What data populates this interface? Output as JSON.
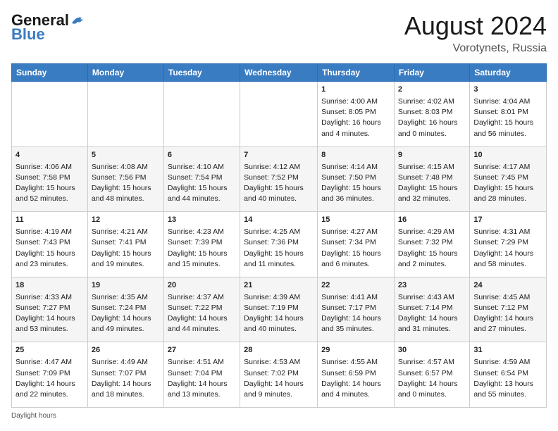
{
  "header": {
    "logo_line1": "General",
    "logo_line2": "Blue",
    "month_year": "August 2024",
    "location": "Vorotynets, Russia"
  },
  "days_of_week": [
    "Sunday",
    "Monday",
    "Tuesday",
    "Wednesday",
    "Thursday",
    "Friday",
    "Saturday"
  ],
  "weeks": [
    [
      {
        "day": "",
        "lines": []
      },
      {
        "day": "",
        "lines": []
      },
      {
        "day": "",
        "lines": []
      },
      {
        "day": "",
        "lines": []
      },
      {
        "day": "1",
        "lines": [
          "Sunrise: 4:00 AM",
          "Sunset: 8:05 PM",
          "Daylight: 16 hours",
          "and 4 minutes."
        ]
      },
      {
        "day": "2",
        "lines": [
          "Sunrise: 4:02 AM",
          "Sunset: 8:03 PM",
          "Daylight: 16 hours",
          "and 0 minutes."
        ]
      },
      {
        "day": "3",
        "lines": [
          "Sunrise: 4:04 AM",
          "Sunset: 8:01 PM",
          "Daylight: 15 hours",
          "and 56 minutes."
        ]
      }
    ],
    [
      {
        "day": "4",
        "lines": [
          "Sunrise: 4:06 AM",
          "Sunset: 7:58 PM",
          "Daylight: 15 hours",
          "and 52 minutes."
        ]
      },
      {
        "day": "5",
        "lines": [
          "Sunrise: 4:08 AM",
          "Sunset: 7:56 PM",
          "Daylight: 15 hours",
          "and 48 minutes."
        ]
      },
      {
        "day": "6",
        "lines": [
          "Sunrise: 4:10 AM",
          "Sunset: 7:54 PM",
          "Daylight: 15 hours",
          "and 44 minutes."
        ]
      },
      {
        "day": "7",
        "lines": [
          "Sunrise: 4:12 AM",
          "Sunset: 7:52 PM",
          "Daylight: 15 hours",
          "and 40 minutes."
        ]
      },
      {
        "day": "8",
        "lines": [
          "Sunrise: 4:14 AM",
          "Sunset: 7:50 PM",
          "Daylight: 15 hours",
          "and 36 minutes."
        ]
      },
      {
        "day": "9",
        "lines": [
          "Sunrise: 4:15 AM",
          "Sunset: 7:48 PM",
          "Daylight: 15 hours",
          "and 32 minutes."
        ]
      },
      {
        "day": "10",
        "lines": [
          "Sunrise: 4:17 AM",
          "Sunset: 7:45 PM",
          "Daylight: 15 hours",
          "and 28 minutes."
        ]
      }
    ],
    [
      {
        "day": "11",
        "lines": [
          "Sunrise: 4:19 AM",
          "Sunset: 7:43 PM",
          "Daylight: 15 hours",
          "and 23 minutes."
        ]
      },
      {
        "day": "12",
        "lines": [
          "Sunrise: 4:21 AM",
          "Sunset: 7:41 PM",
          "Daylight: 15 hours",
          "and 19 minutes."
        ]
      },
      {
        "day": "13",
        "lines": [
          "Sunrise: 4:23 AM",
          "Sunset: 7:39 PM",
          "Daylight: 15 hours",
          "and 15 minutes."
        ]
      },
      {
        "day": "14",
        "lines": [
          "Sunrise: 4:25 AM",
          "Sunset: 7:36 PM",
          "Daylight: 15 hours",
          "and 11 minutes."
        ]
      },
      {
        "day": "15",
        "lines": [
          "Sunrise: 4:27 AM",
          "Sunset: 7:34 PM",
          "Daylight: 15 hours",
          "and 6 minutes."
        ]
      },
      {
        "day": "16",
        "lines": [
          "Sunrise: 4:29 AM",
          "Sunset: 7:32 PM",
          "Daylight: 15 hours",
          "and 2 minutes."
        ]
      },
      {
        "day": "17",
        "lines": [
          "Sunrise: 4:31 AM",
          "Sunset: 7:29 PM",
          "Daylight: 14 hours",
          "and 58 minutes."
        ]
      }
    ],
    [
      {
        "day": "18",
        "lines": [
          "Sunrise: 4:33 AM",
          "Sunset: 7:27 PM",
          "Daylight: 14 hours",
          "and 53 minutes."
        ]
      },
      {
        "day": "19",
        "lines": [
          "Sunrise: 4:35 AM",
          "Sunset: 7:24 PM",
          "Daylight: 14 hours",
          "and 49 minutes."
        ]
      },
      {
        "day": "20",
        "lines": [
          "Sunrise: 4:37 AM",
          "Sunset: 7:22 PM",
          "Daylight: 14 hours",
          "and 44 minutes."
        ]
      },
      {
        "day": "21",
        "lines": [
          "Sunrise: 4:39 AM",
          "Sunset: 7:19 PM",
          "Daylight: 14 hours",
          "and 40 minutes."
        ]
      },
      {
        "day": "22",
        "lines": [
          "Sunrise: 4:41 AM",
          "Sunset: 7:17 PM",
          "Daylight: 14 hours",
          "and 35 minutes."
        ]
      },
      {
        "day": "23",
        "lines": [
          "Sunrise: 4:43 AM",
          "Sunset: 7:14 PM",
          "Daylight: 14 hours",
          "and 31 minutes."
        ]
      },
      {
        "day": "24",
        "lines": [
          "Sunrise: 4:45 AM",
          "Sunset: 7:12 PM",
          "Daylight: 14 hours",
          "and 27 minutes."
        ]
      }
    ],
    [
      {
        "day": "25",
        "lines": [
          "Sunrise: 4:47 AM",
          "Sunset: 7:09 PM",
          "Daylight: 14 hours",
          "and 22 minutes."
        ]
      },
      {
        "day": "26",
        "lines": [
          "Sunrise: 4:49 AM",
          "Sunset: 7:07 PM",
          "Daylight: 14 hours",
          "and 18 minutes."
        ]
      },
      {
        "day": "27",
        "lines": [
          "Sunrise: 4:51 AM",
          "Sunset: 7:04 PM",
          "Daylight: 14 hours",
          "and 13 minutes."
        ]
      },
      {
        "day": "28",
        "lines": [
          "Sunrise: 4:53 AM",
          "Sunset: 7:02 PM",
          "Daylight: 14 hours",
          "and 9 minutes."
        ]
      },
      {
        "day": "29",
        "lines": [
          "Sunrise: 4:55 AM",
          "Sunset: 6:59 PM",
          "Daylight: 14 hours",
          "and 4 minutes."
        ]
      },
      {
        "day": "30",
        "lines": [
          "Sunrise: 4:57 AM",
          "Sunset: 6:57 PM",
          "Daylight: 14 hours",
          "and 0 minutes."
        ]
      },
      {
        "day": "31",
        "lines": [
          "Sunrise: 4:59 AM",
          "Sunset: 6:54 PM",
          "Daylight: 13 hours",
          "and 55 minutes."
        ]
      }
    ]
  ],
  "footer": {
    "daylight_label": "Daylight hours"
  }
}
